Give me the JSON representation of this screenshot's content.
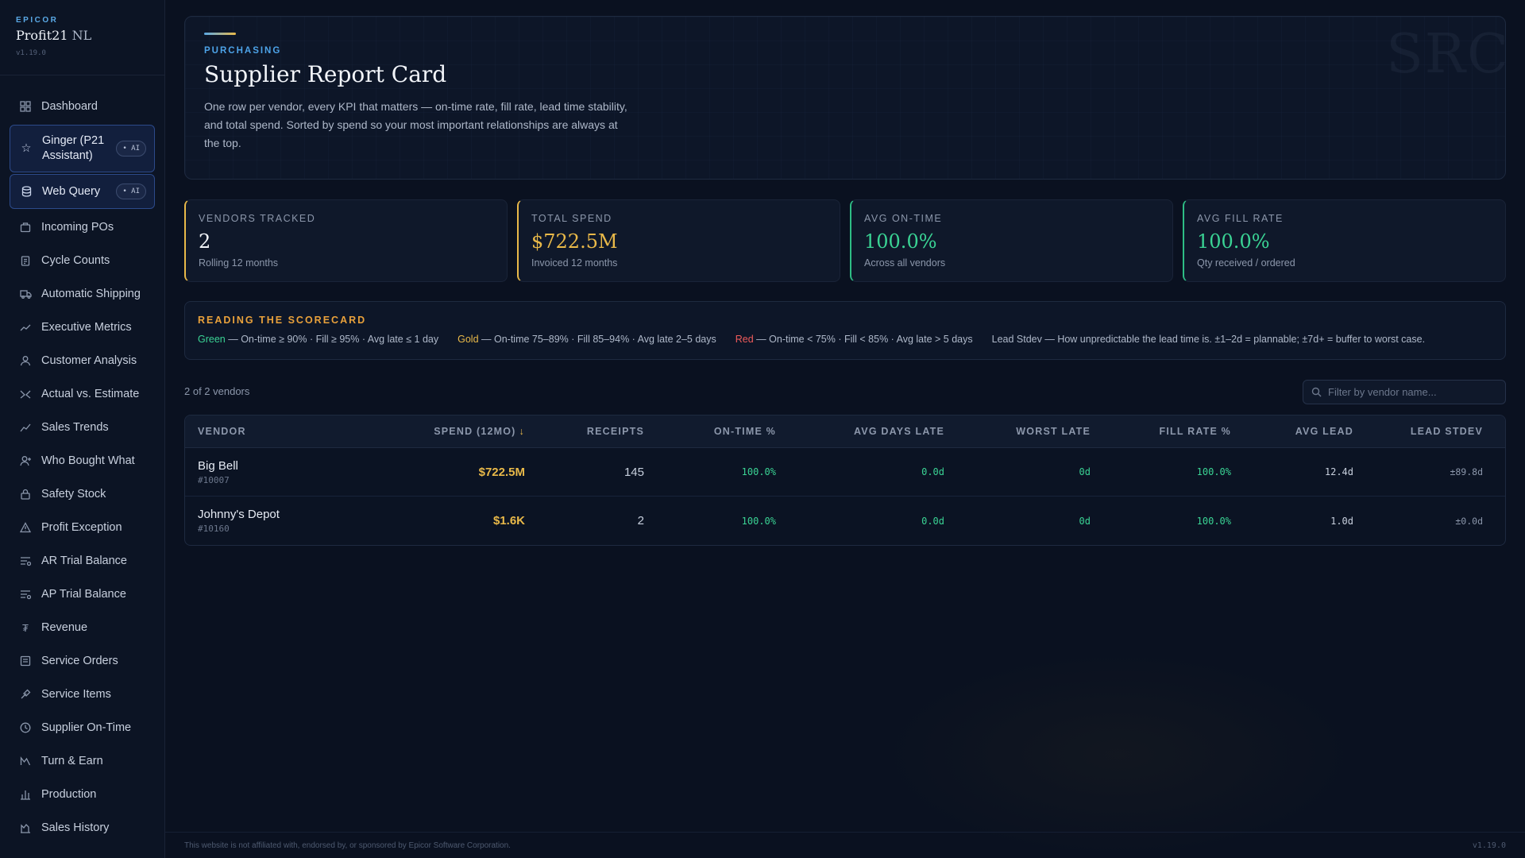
{
  "brand": {
    "vendor": "EPICOR",
    "product": "Profit21",
    "product_suffix": "NL",
    "version": "v1.19.0"
  },
  "sidebar": {
    "items": [
      {
        "label": "Dashboard",
        "icon": "grid-icon"
      },
      {
        "label": "Ginger (P21 Assistant)",
        "icon": "star-icon",
        "badge": "AI"
      },
      {
        "label": "Web Query",
        "icon": "database-icon",
        "badge": "AI"
      },
      {
        "label": "Incoming POs",
        "icon": "package-icon"
      },
      {
        "label": "Cycle Counts",
        "icon": "clipboard-icon"
      },
      {
        "label": "Automatic Shipping",
        "icon": "truck-icon"
      },
      {
        "label": "Executive Metrics",
        "icon": "trend-icon"
      },
      {
        "label": "Customer Analysis",
        "icon": "user-icon"
      },
      {
        "label": "Actual vs. Estimate",
        "icon": "compare-icon"
      },
      {
        "label": "Sales Trends",
        "icon": "chart-line-icon"
      },
      {
        "label": "Who Bought What",
        "icon": "user-plus-icon"
      },
      {
        "label": "Safety Stock",
        "icon": "lock-icon"
      },
      {
        "label": "Profit Exception",
        "icon": "warning-icon"
      },
      {
        "label": "AR Trial Balance",
        "icon": "ledger-icon"
      },
      {
        "label": "AP Trial Balance",
        "icon": "ledger-icon"
      },
      {
        "label": "Revenue",
        "icon": "currency-icon"
      },
      {
        "label": "Service Orders",
        "icon": "document-icon"
      },
      {
        "label": "Service Items",
        "icon": "wrench-icon"
      },
      {
        "label": "Supplier On-Time",
        "icon": "clock-icon"
      },
      {
        "label": "Turn & Earn",
        "icon": "turn-icon"
      },
      {
        "label": "Production",
        "icon": "bar-chart-icon"
      },
      {
        "label": "Sales History",
        "icon": "history-icon"
      }
    ]
  },
  "hero": {
    "eyebrow": "PURCHASING",
    "title": "Supplier Report Card",
    "description": "One row per vendor, every KPI that matters — on-time rate, fill rate, lead time stability, and total spend. Sorted by spend so your most important relationships are always at the top.",
    "watermark": "SRC"
  },
  "kpis": [
    {
      "label": "VENDORS TRACKED",
      "value": "2",
      "sub": "Rolling 12 months"
    },
    {
      "label": "TOTAL SPEND",
      "value": "$722.5M",
      "sub": "Invoiced 12 months"
    },
    {
      "label": "AVG ON-TIME",
      "value": "100.0%",
      "sub": "Across all vendors"
    },
    {
      "label": "AVG FILL RATE",
      "value": "100.0%",
      "sub": "Qty received / ordered"
    }
  ],
  "legend": {
    "title": "READING THE SCORECARD",
    "green_word": "Green",
    "green_text": " — On-time ≥ 90% · Fill ≥ 95% · Avg late ≤ 1 day",
    "gold_word": "Gold",
    "gold_text": " — On-time 75–89% · Fill 85–94% · Avg late 2–5 days",
    "red_word": "Red",
    "red_text": " — On-time < 75% · Fill < 85% · Avg late > 5 days",
    "lead_text": "Lead Stdev — How unpredictable the lead time is. ±1–2d = plannable; ±7d+ = buffer to worst case."
  },
  "toolbar": {
    "count": "2 of 2 vendors",
    "filter_placeholder": "Filter by vendor name..."
  },
  "table": {
    "headers": {
      "vendor": "VENDOR",
      "spend": "SPEND (12MO)",
      "receipts": "RECEIPTS",
      "ontime": "ON-TIME %",
      "avg_late": "AVG DAYS LATE",
      "worst_late": "WORST LATE",
      "fill": "FILL RATE %",
      "avg_lead": "AVG LEAD",
      "stdev": "LEAD STDEV"
    },
    "rows": [
      {
        "vendor": "Big Bell",
        "id": "#10007",
        "spend": "$722.5M",
        "receipts": "145",
        "ontime": "100.0%",
        "avg_late": "0.0d",
        "worst_late": "0d",
        "fill": "100.0%",
        "avg_lead": "12.4d",
        "stdev": "±89.8d"
      },
      {
        "vendor": "Johnny's Depot",
        "id": "#10160",
        "spend": "$1.6K",
        "receipts": "2",
        "ontime": "100.0%",
        "avg_late": "0.0d",
        "worst_late": "0d",
        "fill": "100.0%",
        "avg_lead": "1.0d",
        "stdev": "±0.0d"
      }
    ]
  },
  "footer": {
    "disclaimer": "This website is not affiliated with, endorsed by, or sponsored by Epicor Software Corporation.",
    "version": "v1.19.0"
  },
  "colors": {
    "accent_blue": "#4da3e8",
    "gold": "#e9b949",
    "green": "#3ad394",
    "red": "#ef5b5b"
  }
}
